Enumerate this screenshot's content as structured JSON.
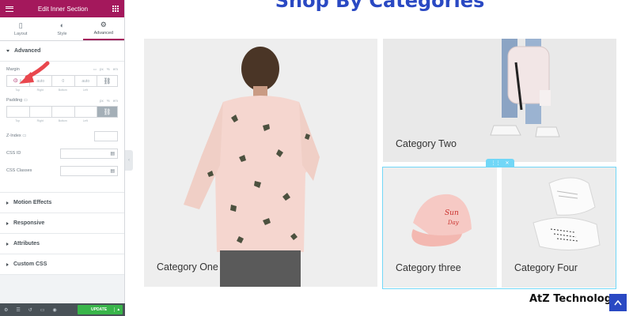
{
  "panel": {
    "title": "Edit Inner Section",
    "tabs": [
      {
        "label": "Layout",
        "icon": "layout-icon"
      },
      {
        "label": "Style",
        "icon": "style-icon"
      },
      {
        "label": "Advanced",
        "icon": "gear-icon"
      }
    ],
    "active_tab": "Advanced",
    "advanced": {
      "section_label": "Advanced",
      "margin_label": "Margin",
      "margin_units": [
        "px",
        "%",
        "em"
      ],
      "margin_fields": [
        "auto",
        "0",
        "auto"
      ],
      "margin_labels": [
        "Top",
        "Right",
        "Bottom",
        "Left"
      ],
      "padding_label": "Padding",
      "padding_units": [
        "px",
        "%",
        "em"
      ],
      "padding_labels": [
        "Top",
        "Right",
        "Bottom",
        "Left"
      ],
      "zindex_label": "Z-Index",
      "css_id_label": "CSS ID",
      "css_classes_label": "CSS Classes"
    },
    "collapsed_sections": [
      "Motion Effects",
      "Responsive",
      "Attributes",
      "Custom CSS"
    ],
    "update_label": "UPDATE"
  },
  "preview": {
    "heading": "Shop By Categories",
    "categories": [
      {
        "label": "Category One"
      },
      {
        "label": "Category Two"
      },
      {
        "label": "Category three"
      },
      {
        "label": "Category Four"
      }
    ],
    "brand": "AtZ Technology"
  },
  "colors": {
    "panel_header": "#a4185c",
    "heading_blue": "#2a49c3",
    "update_green": "#39b54a",
    "outline_cyan": "#71d7f7"
  }
}
